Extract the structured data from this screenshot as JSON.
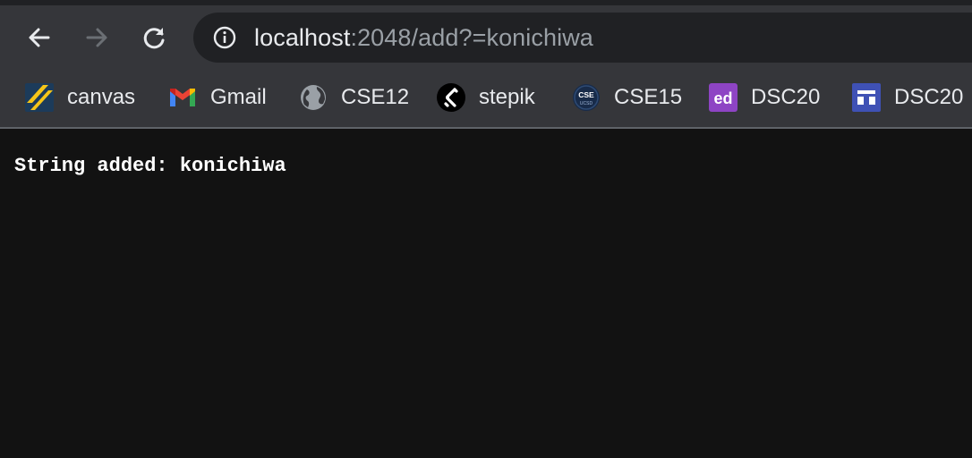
{
  "toolbar": {
    "back_icon": "arrow-left-icon",
    "forward_icon": "arrow-right-icon",
    "reload_icon": "reload-icon"
  },
  "address_bar": {
    "site_info_icon": "info-icon",
    "host": "localhost",
    "rest": ":2048/add?=konichiwa"
  },
  "bookmarks": [
    {
      "label": "canvas",
      "icon": "canvas-icon"
    },
    {
      "label": "Gmail",
      "icon": "gmail-icon"
    },
    {
      "label": "CSE12",
      "icon": "globe-icon"
    },
    {
      "label": "stepik",
      "icon": "stepik-icon"
    },
    {
      "label": "CSE15",
      "icon": "cse-ucsd-icon"
    },
    {
      "label": "DSC20",
      "icon": "ed-icon"
    },
    {
      "label": "DSC20",
      "icon": "layout-icon"
    }
  ],
  "page": {
    "message": "String added: konichiwa"
  },
  "colors": {
    "toolbar_bg": "#35363a",
    "omnibox_bg": "#202124",
    "page_bg": "#121212",
    "text_primary": "#e8eaed",
    "text_secondary": "#9aa0a6"
  }
}
